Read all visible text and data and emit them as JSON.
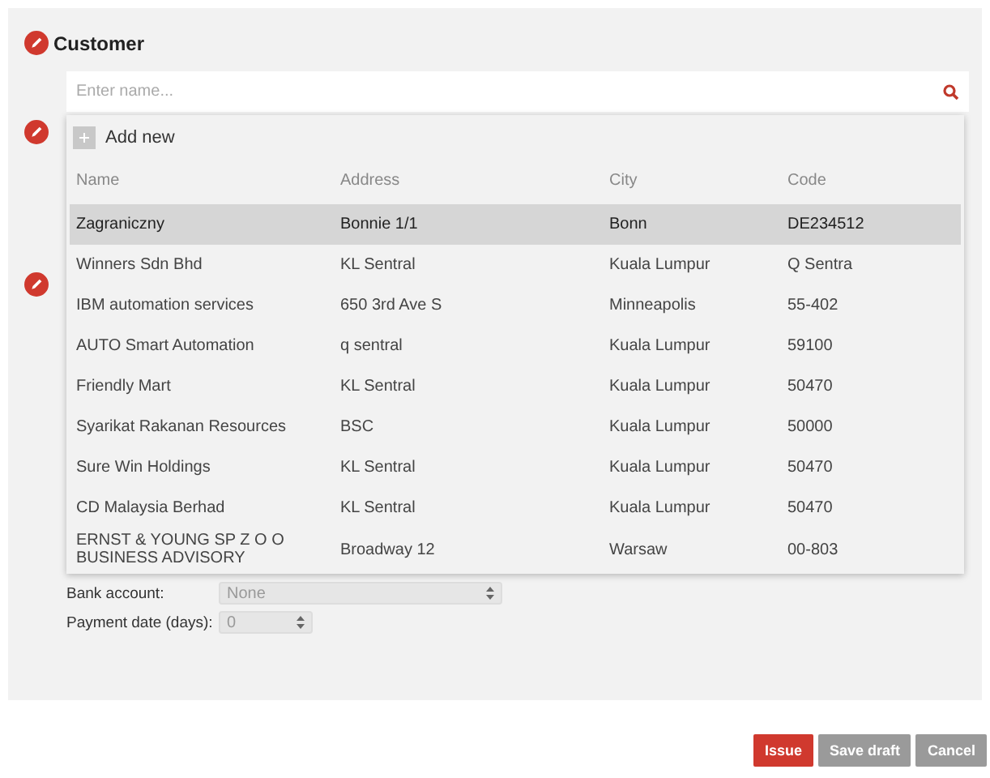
{
  "section": {
    "title": "Customer"
  },
  "search": {
    "placeholder": "Enter name..."
  },
  "dropdown": {
    "add_new": "Add new",
    "columns": [
      "Name",
      "Address",
      "City",
      "Code"
    ],
    "rows": [
      {
        "cells": [
          "Zagraniczny",
          "Bonnie 1/1",
          "Bonn",
          "DE234512"
        ],
        "selected": true
      },
      {
        "cells": [
          "Winners Sdn Bhd",
          "KL Sentral",
          "Kuala Lumpur",
          "Q Sentra"
        ],
        "selected": false
      },
      {
        "cells": [
          "IBM automation services",
          "650 3rd Ave S",
          "Minneapolis",
          "55-402"
        ],
        "selected": false
      },
      {
        "cells": [
          "AUTO Smart Automation",
          "q sentral",
          "Kuala Lumpur",
          "59100"
        ],
        "selected": false
      },
      {
        "cells": [
          "Friendly Mart",
          "KL Sentral",
          "Kuala Lumpur",
          "50470"
        ],
        "selected": false
      },
      {
        "cells": [
          "Syarikat Rakanan Resources",
          "BSC",
          "Kuala Lumpur",
          "50000"
        ],
        "selected": false
      },
      {
        "cells": [
          "Sure Win Holdings",
          "KL Sentral",
          "Kuala Lumpur",
          "50470"
        ],
        "selected": false
      },
      {
        "cells": [
          "CD Malaysia Berhad",
          "KL Sentral",
          "Kuala Lumpur",
          "50470"
        ],
        "selected": false
      },
      {
        "cells": [
          "ERNST & YOUNG SP Z O O BUSINESS ADVISORY",
          "Broadway 12",
          "Warsaw",
          "00-803"
        ],
        "selected": false
      }
    ]
  },
  "fields": [
    {
      "label": "Bank account:",
      "value": "None",
      "kind": "wide"
    },
    {
      "label": "Payment date (days):",
      "value": "0",
      "kind": "narrow"
    }
  ],
  "buttons": [
    {
      "label": "Issue",
      "kind": "primary"
    },
    {
      "label": "Save draft",
      "kind": "disabled"
    },
    {
      "label": "Cancel",
      "kind": "disabled"
    }
  ]
}
